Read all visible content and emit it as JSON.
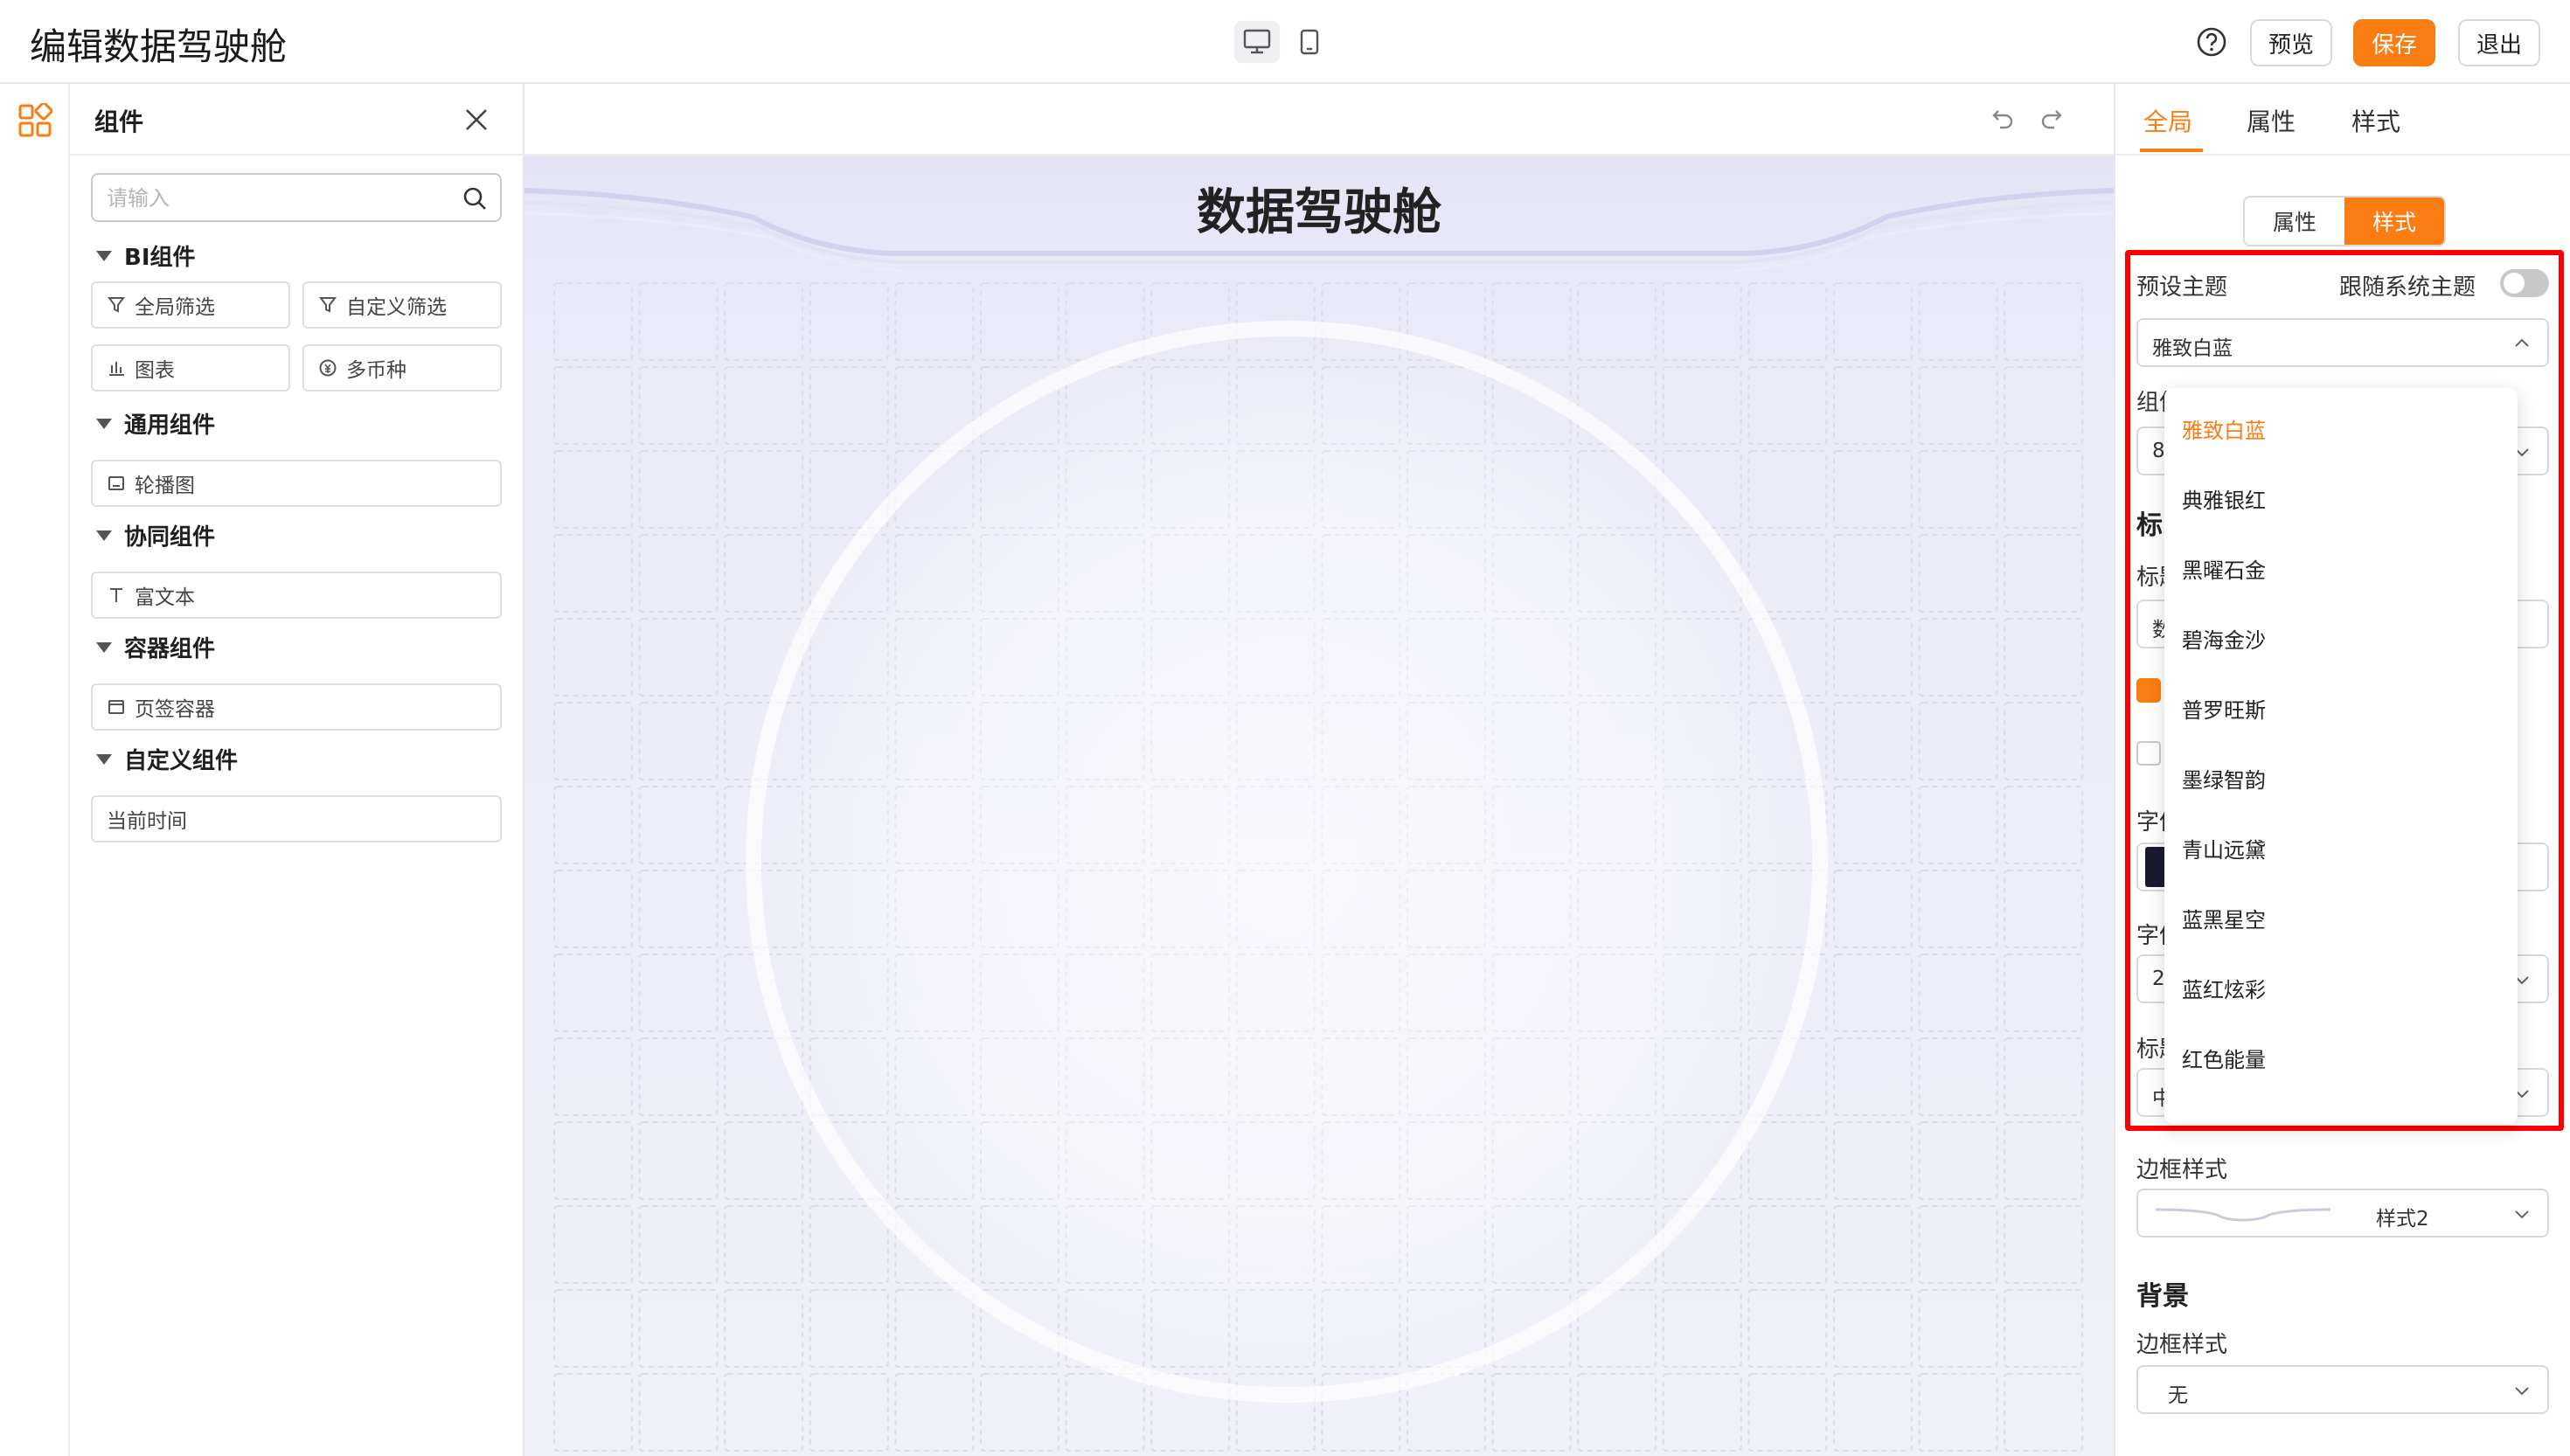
{
  "header": {
    "title": "编辑数据驾驶舱",
    "preview_label": "预览",
    "save_label": "保存",
    "exit_label": "退出"
  },
  "components_panel": {
    "title": "组件",
    "search_placeholder": "请输入",
    "groups": [
      {
        "title": "BI组件",
        "items": [
          {
            "label": "全局筛选",
            "icon": "filter-icon"
          },
          {
            "label": "自定义筛选",
            "icon": "filter-icon"
          },
          {
            "label": "图表",
            "icon": "bar-chart-icon"
          },
          {
            "label": "多币种",
            "icon": "currency-icon"
          }
        ]
      },
      {
        "title": "通用组件",
        "items": [
          {
            "label": "轮播图",
            "icon": "carousel-icon"
          }
        ]
      },
      {
        "title": "协同组件",
        "items": [
          {
            "label": "富文本",
            "icon": "text-icon"
          }
        ]
      },
      {
        "title": "容器组件",
        "items": [
          {
            "label": "页签容器",
            "icon": "tab-container-icon"
          }
        ]
      },
      {
        "title": "自定义组件",
        "items": [
          {
            "label": "当前时间",
            "icon": ""
          }
        ]
      }
    ]
  },
  "canvas": {
    "title": "数据驾驶舱"
  },
  "settings": {
    "tabs": [
      {
        "label": "全局"
      },
      {
        "label": "属性"
      },
      {
        "label": "样式"
      }
    ],
    "segmented": [
      {
        "label": "属性"
      },
      {
        "label": "样式"
      }
    ],
    "preset_theme_label": "预设主题",
    "follow_system_label": "跟随系统主题",
    "theme_value": "雅致白蓝",
    "partial_labels": {
      "component": "组件",
      "c_value": "8",
      "title_heading": "标",
      "title_label": "标题",
      "title_value": "数",
      "font_label": "字体",
      "size_label": "字体",
      "size_value": "2",
      "align_label": "标题",
      "align_value": "中"
    },
    "border_style_label": "边框样式",
    "border_style_value": "样式2",
    "background_heading": "背景",
    "background_border_label": "边框样式",
    "background_border_value": "无"
  },
  "theme_dropdown": {
    "options": [
      "雅致白蓝",
      "典雅银红",
      "黑曜石金",
      "碧海金沙",
      "普罗旺斯",
      "墨绿智韵",
      "青山远黛",
      "蓝黑星空",
      "蓝红炫彩",
      "红色能量"
    ],
    "selected": "雅致白蓝"
  },
  "colors": {
    "accent": "#fa7d14",
    "highlight_box": "#ff0000",
    "canvas_bg": "#f0f0f8"
  }
}
